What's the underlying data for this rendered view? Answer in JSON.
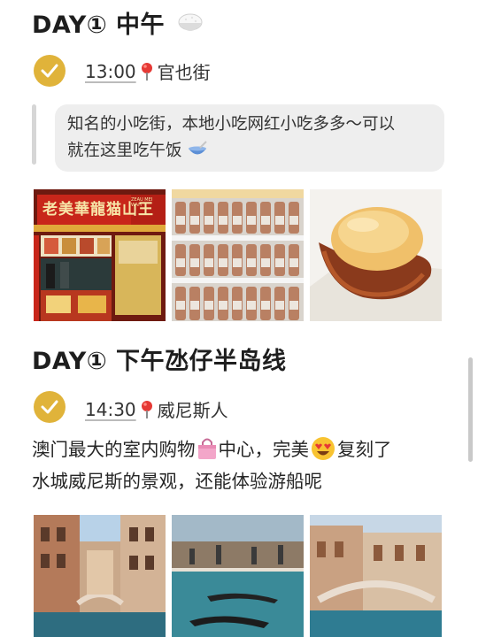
{
  "section1": {
    "heading": "DAY① 中午",
    "time": "13:00",
    "place": "官也街",
    "note_line1": "知名的小吃街，本地小吃网红小吃多多～可以",
    "note_line2": "就在这里吃午饭",
    "shop_sign": "老美華龍猫山王",
    "shop_sign_small": "ZEAU MEI WAH"
  },
  "section2": {
    "heading": "DAY① 下午氹仔半岛线",
    "time": "14:30",
    "place": "威尼斯人",
    "para_line1_a": "澳门最大的室内购物",
    "para_line1_b": "中心，完美",
    "para_line1_c": "复刻了",
    "para_line2": "水城威尼斯的景观，还能体验游船呢"
  },
  "colors": {
    "check": "#e0b33a",
    "pin": "#e53935",
    "bubble": "#eeeeee"
  },
  "icons": [
    "rice-bowl-icon",
    "check-icon",
    "location-pin-icon",
    "soup-bowl-icon",
    "shopping-bag-icon",
    "heart-eyes-icon"
  ]
}
